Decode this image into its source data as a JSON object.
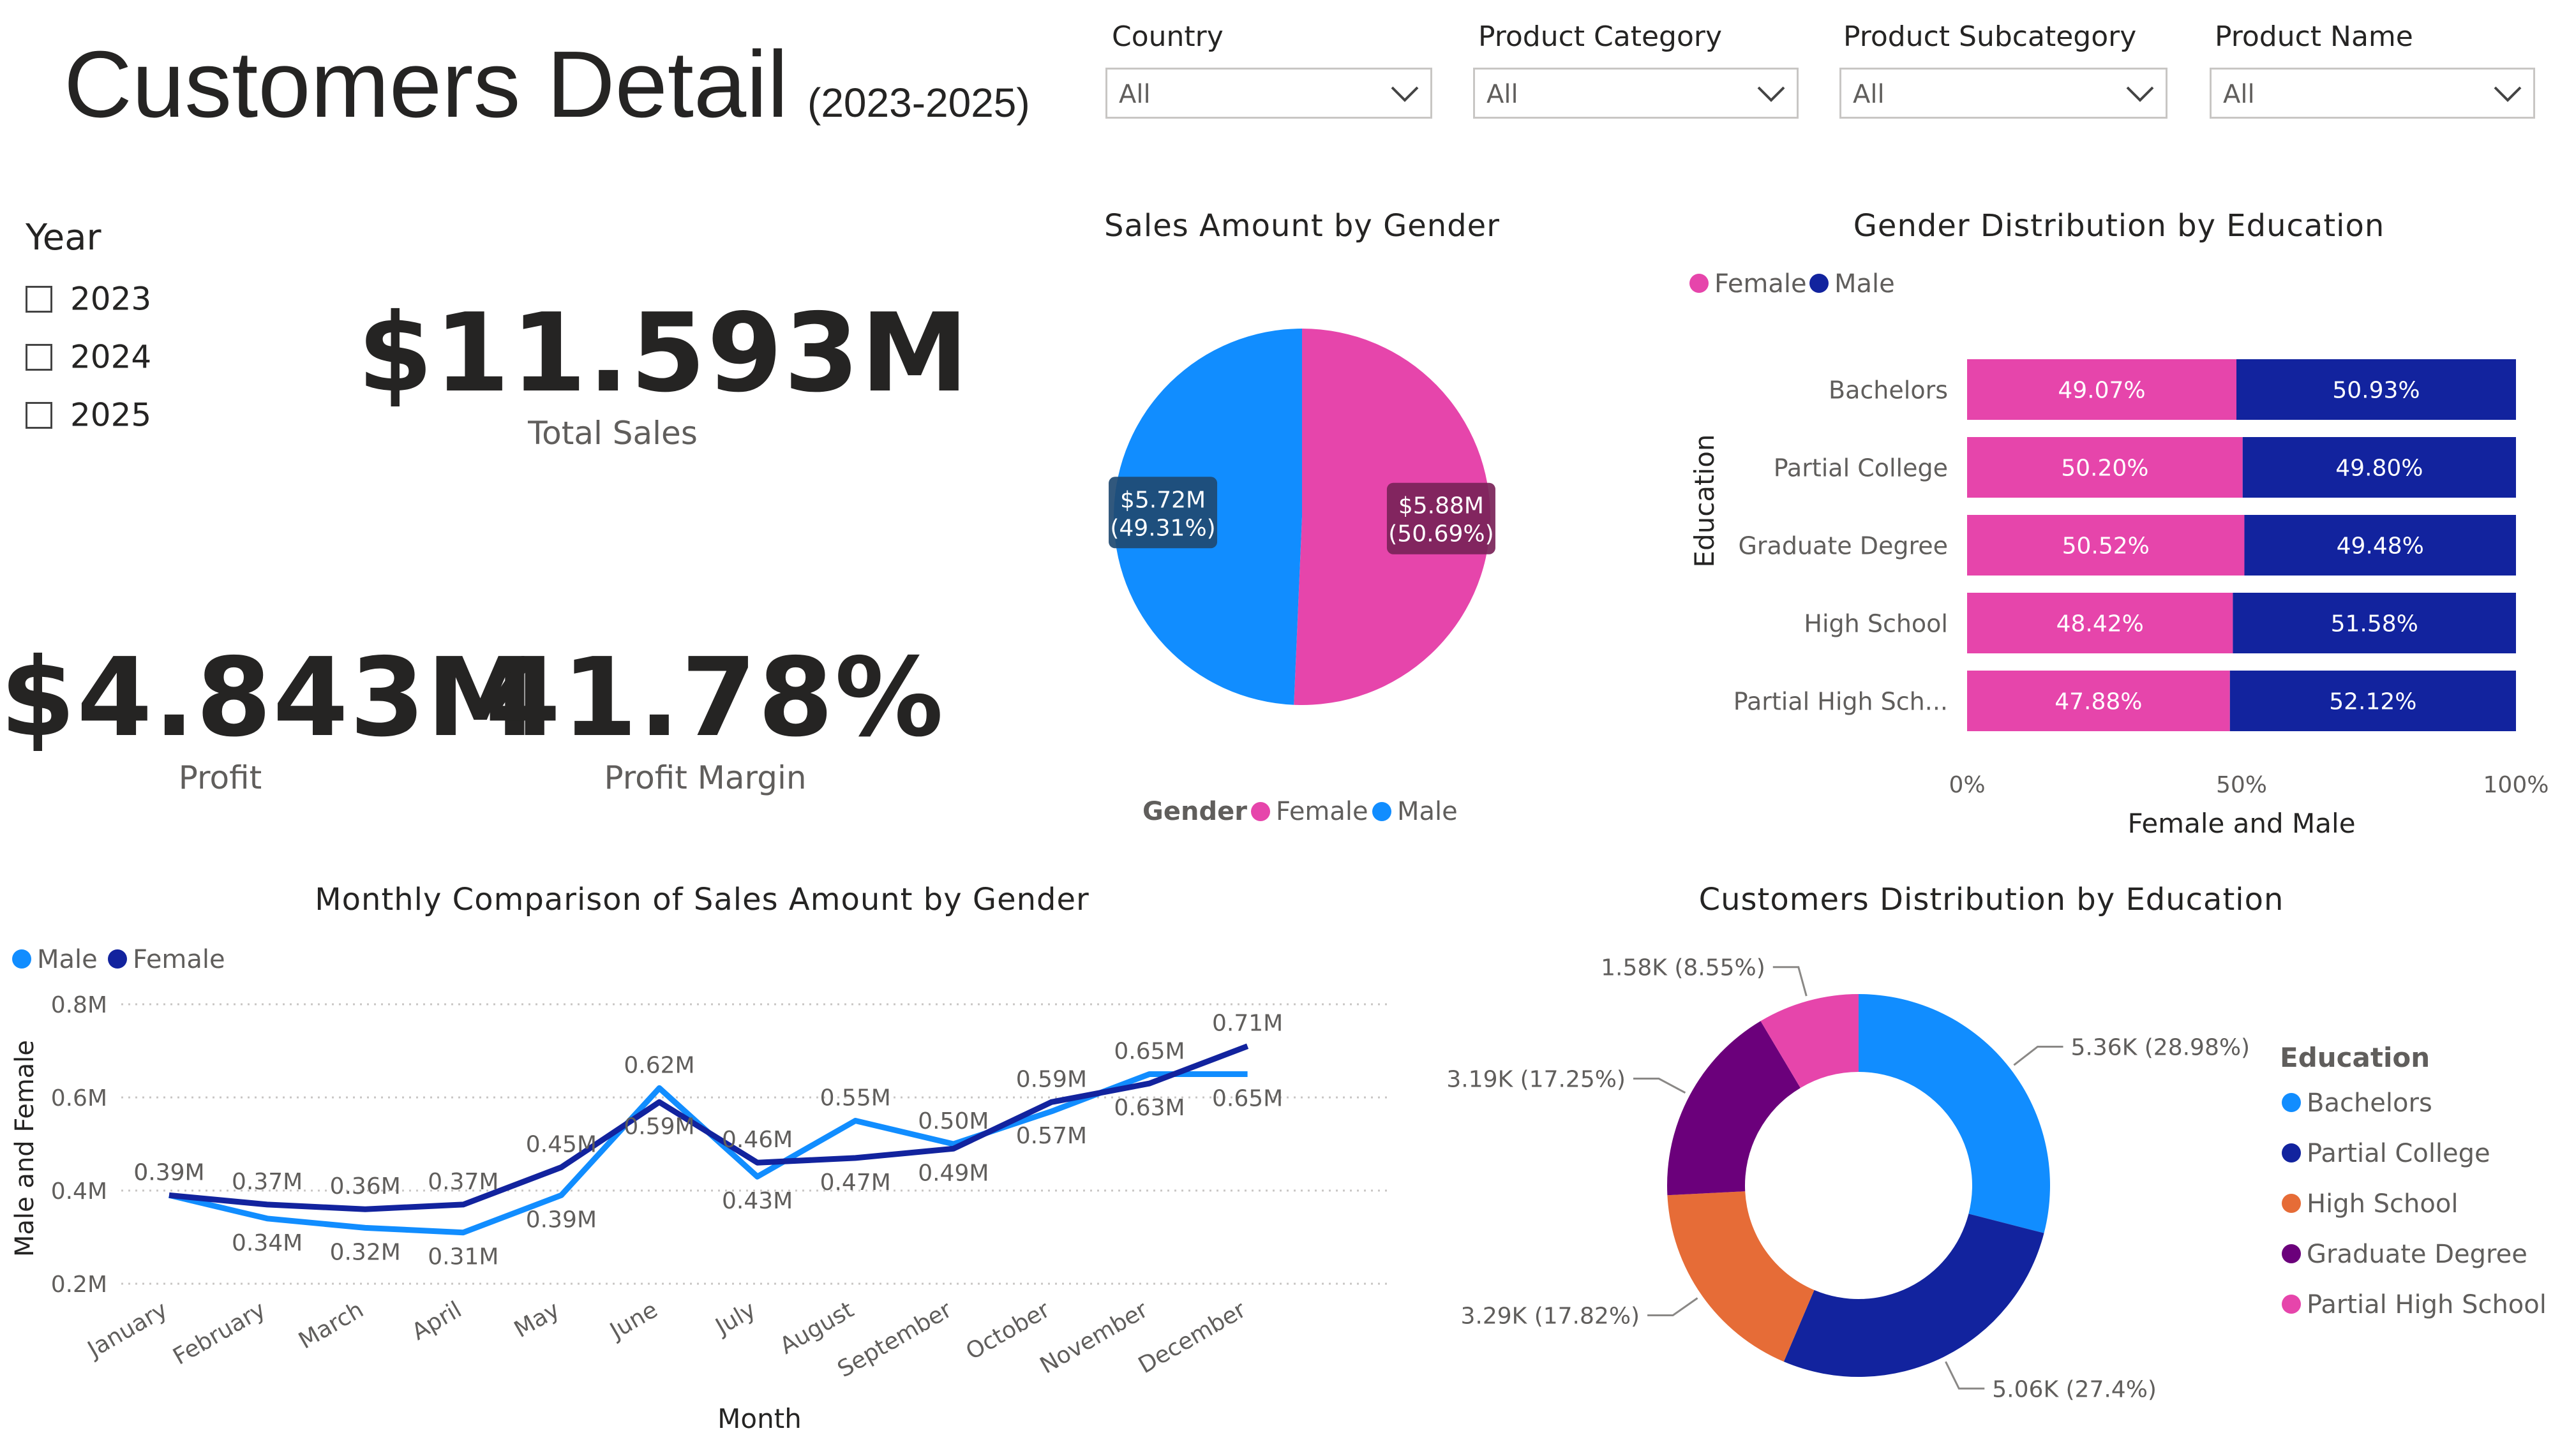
{
  "header": {
    "title": "Customers Detail",
    "subtitle": "(2023-2025)"
  },
  "filters": [
    {
      "label": "Country",
      "value": "All"
    },
    {
      "label": "Product Category",
      "value": "All"
    },
    {
      "label": "Product Subcategory",
      "value": "All"
    },
    {
      "label": "Product Name",
      "value": "All"
    }
  ],
  "year_slicer": {
    "title": "Year",
    "options": [
      "2023",
      "2024",
      "2025"
    ]
  },
  "kpis": {
    "total_sales": {
      "value": "$11.593M",
      "label": "Total Sales"
    },
    "profit": {
      "value": "$4.843M",
      "label": "Profit"
    },
    "profit_margin": {
      "value": "41.78%",
      "label": "Profit Margin"
    }
  },
  "colors": {
    "female_pink": "#e645ab",
    "male_blue": "#118dff",
    "navy": "#12239e",
    "orange": "#e66c37",
    "purple": "#6b007b"
  },
  "chart_data": [
    {
      "id": "sales-by-gender",
      "type": "pie",
      "title": "Sales Amount by Gender",
      "legend_title": "Gender",
      "legend": [
        "Female",
        "Male"
      ],
      "slices": [
        {
          "name": "Female",
          "value": 5.88,
          "label_value": "$5.88M",
          "label_pct": "(50.69%)",
          "pct": 50.69,
          "color": "#e645ab"
        },
        {
          "name": "Male",
          "value": 5.72,
          "label_value": "$5.72M",
          "label_pct": "(49.31%)",
          "pct": 49.31,
          "color": "#118dff"
        }
      ]
    },
    {
      "id": "gender-by-education",
      "type": "bar",
      "title": "Gender Distribution by Education",
      "xlabel": "Female and Male",
      "ylabel": "Education",
      "legend": [
        "Female",
        "Male"
      ],
      "categories": [
        "Bachelors",
        "Partial College",
        "Graduate Degree",
        "High School",
        "Partial High Sch..."
      ],
      "series": [
        {
          "name": "Female",
          "color": "#e645ab",
          "values": [
            49.07,
            50.2,
            50.52,
            48.42,
            47.88
          ],
          "labels": [
            "49.07%",
            "50.20%",
            "50.52%",
            "48.42%",
            "47.88%"
          ]
        },
        {
          "name": "Male",
          "color": "#12239e",
          "values": [
            50.93,
            49.8,
            49.48,
            51.58,
            52.12
          ],
          "labels": [
            "50.93%",
            "49.80%",
            "49.48%",
            "51.58%",
            "52.12%"
          ]
        }
      ],
      "xticks": [
        "0%",
        "50%",
        "100%"
      ]
    },
    {
      "id": "monthly-sales-by-gender",
      "type": "line",
      "title": "Monthly Comparison of Sales Amount by Gender",
      "xlabel": "Month",
      "ylabel": "Male and Female",
      "legend": [
        "Male",
        "Female"
      ],
      "categories": [
        "January",
        "February",
        "March",
        "April",
        "May",
        "June",
        "July",
        "August",
        "September",
        "October",
        "November",
        "December"
      ],
      "yticks": [
        "0.2M",
        "0.4M",
        "0.6M",
        "0.8M"
      ],
      "ylim": [
        0.2,
        0.8
      ],
      "series": [
        {
          "name": "Male",
          "color": "#118dff",
          "values": [
            0.39,
            0.34,
            0.32,
            0.31,
            0.39,
            0.62,
            0.43,
            0.55,
            0.5,
            0.57,
            0.65,
            0.65
          ],
          "labels": [
            "0.39M",
            "0.34M",
            "0.32M",
            "0.31M",
            "0.39M",
            "0.62M",
            "0.43M",
            "0.55M",
            "0.50M",
            "0.57M",
            "0.65M",
            "0.65M"
          ]
        },
        {
          "name": "Female",
          "color": "#12239e",
          "values": [
            0.39,
            0.37,
            0.36,
            0.37,
            0.45,
            0.59,
            0.46,
            0.47,
            0.49,
            0.59,
            0.63,
            0.71
          ],
          "labels": [
            "0.39M",
            "0.37M",
            "0.36M",
            "0.37M",
            "0.45M",
            "0.59M",
            "0.46M",
            "0.47M",
            "0.49M",
            "0.59M",
            "0.63M",
            "0.71M"
          ]
        }
      ]
    },
    {
      "id": "customers-by-education",
      "type": "pie",
      "title": "Customers Distribution by Education",
      "legend_title": "Education",
      "slices": [
        {
          "name": "Bachelors",
          "value": 5.36,
          "label": "5.36K (28.98%)",
          "pct": 28.98,
          "color": "#118dff"
        },
        {
          "name": "Partial College",
          "value": 5.06,
          "label": "5.06K (27.4%)",
          "pct": 27.4,
          "color": "#12239e"
        },
        {
          "name": "High School",
          "value": 3.29,
          "label": "3.29K (17.82%)",
          "pct": 17.82,
          "color": "#e66c37"
        },
        {
          "name": "Graduate Degree",
          "value": 3.19,
          "label": "3.19K (17.25%)",
          "pct": 17.25,
          "color": "#6b007b"
        },
        {
          "name": "Partial High School",
          "value": 1.58,
          "label": "1.58K (8.55%)",
          "pct": 8.55,
          "color": "#e645ab"
        }
      ]
    }
  ]
}
